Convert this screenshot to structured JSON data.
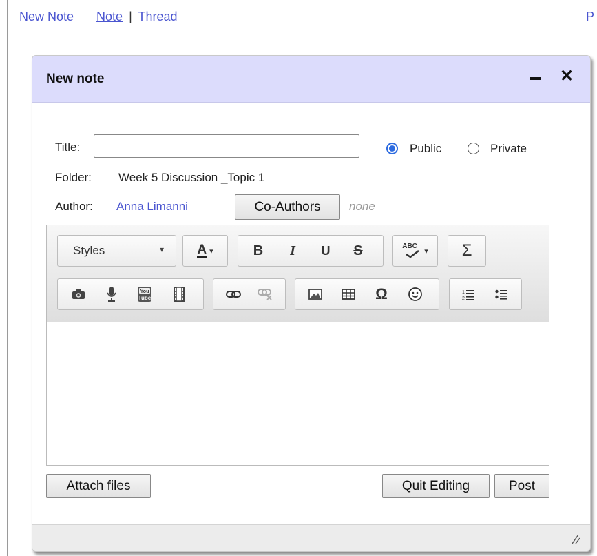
{
  "nav": {
    "new_note": "New Note",
    "note": "Note",
    "separator": "|",
    "thread": "Thread",
    "right_cut": "P"
  },
  "dialog": {
    "title": "New note",
    "title_label": "Title:",
    "title_value": "",
    "visibility": {
      "public_label": "Public",
      "private_label": "Private",
      "selected": "Public"
    },
    "folder_label": "Folder:",
    "folder_value": "Week 5 Discussion _Topic 1",
    "author_label": "Author:",
    "author_name": "Anna Limanni",
    "coauthors_button": "Co-Authors",
    "coauthors_value": "none",
    "editor": {
      "styles_label": "Styles",
      "text_color_label": "A",
      "bold": "B",
      "italic": "I",
      "underline": "U",
      "strike": "S",
      "spell_label": "ABC",
      "sum_label": "Σ",
      "special_char": "Ω",
      "content": ""
    },
    "attach_button": "Attach files",
    "quit_button": "Quit Editing",
    "post_button": "Post"
  },
  "colors": {
    "link": "#4a55d0",
    "header_bg": "#dcdcfc",
    "radio_accent": "#2d6be0"
  }
}
